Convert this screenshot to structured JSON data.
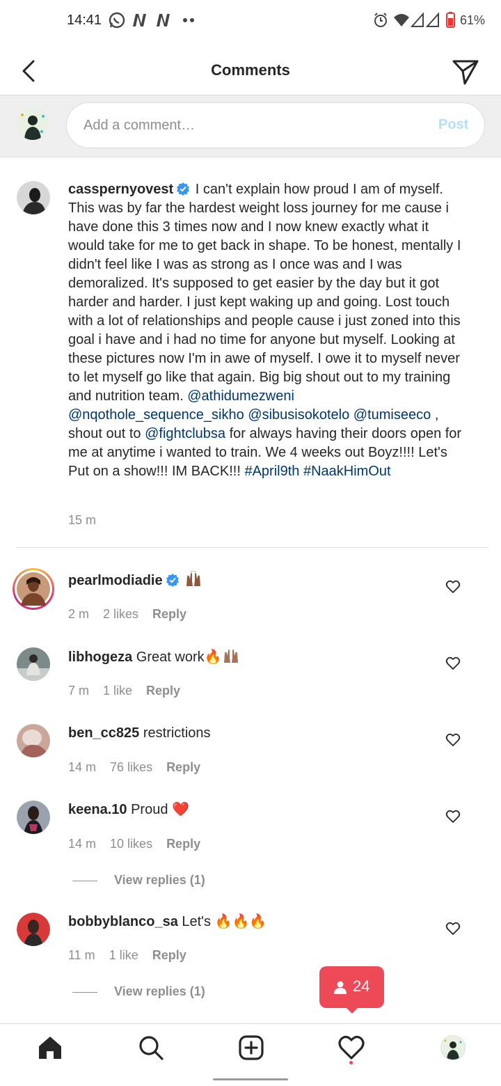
{
  "status_bar": {
    "time": "14:41",
    "battery": "61%"
  },
  "header": {
    "title": "Comments"
  },
  "input": {
    "placeholder": "Add a comment…",
    "post_label": "Post"
  },
  "caption": {
    "username": "casspernyovest",
    "text_plain": "I can't explain how proud I am of myself. This was by far the hardest weight loss journey for me cause i have done this 3 times now and I now knew exactly what it would take for me to get back in shape. To be honest, mentally I didn't feel like I was as strong as I once was and I was demoralized. It's supposed to get easier by the day but it got harder and harder. I just kept waking up and going. Lost touch with a lot of relationships and people cause i just zoned into this goal i have and i had no time for anyone but myself. Looking at these pictures now I'm in awe of myself. I owe it to myself never to let myself go like that again. Big big shout out to my training and nutrition team.",
    "mention_1": "@athidumezweni",
    "mention_2": "@nqothole_sequence_sikho",
    "mention_3": "@sibusisokotelo",
    "mention_4": "@tumiseeco",
    "text_mid": ", shout out to",
    "mention_5": "@fightclubsa",
    "text_end": "for always having their doors open for me at anytime i wanted to train. We 4 weeks out Boyz!!!! Let's Put on a show!!! IM BACK!!!",
    "hashtag_1": "#April9th",
    "hashtag_2": "#NaakHimOut",
    "time": "15 m"
  },
  "comments": [
    {
      "username": "pearlmodiadie",
      "text": "",
      "time": "2 m",
      "likes": "2 likes",
      "reply": "Reply"
    },
    {
      "username": "libhogeza",
      "text": "Great work🔥",
      "time": "7 m",
      "likes": "1 like",
      "reply": "Reply"
    },
    {
      "username": "ben_cc825",
      "text": "restrictions",
      "time": "14 m",
      "likes": "76 likes",
      "reply": "Reply"
    },
    {
      "username": "keena.10",
      "text": "Proud ❤️",
      "time": "14 m",
      "likes": "10 likes",
      "reply": "Reply",
      "view_replies": "View replies (1)"
    },
    {
      "username": "bobbyblanco_sa",
      "text": "Let's 🔥🔥🔥",
      "time": "11 m",
      "likes": "1 like",
      "reply": "Reply",
      "view_replies": "View replies (1)"
    }
  ],
  "notification": {
    "count": "24"
  },
  "colors": {
    "link": "#00376b",
    "accent_red": "#ed4956",
    "verified_blue": "#3897f0",
    "muted": "#8e8e8e"
  }
}
